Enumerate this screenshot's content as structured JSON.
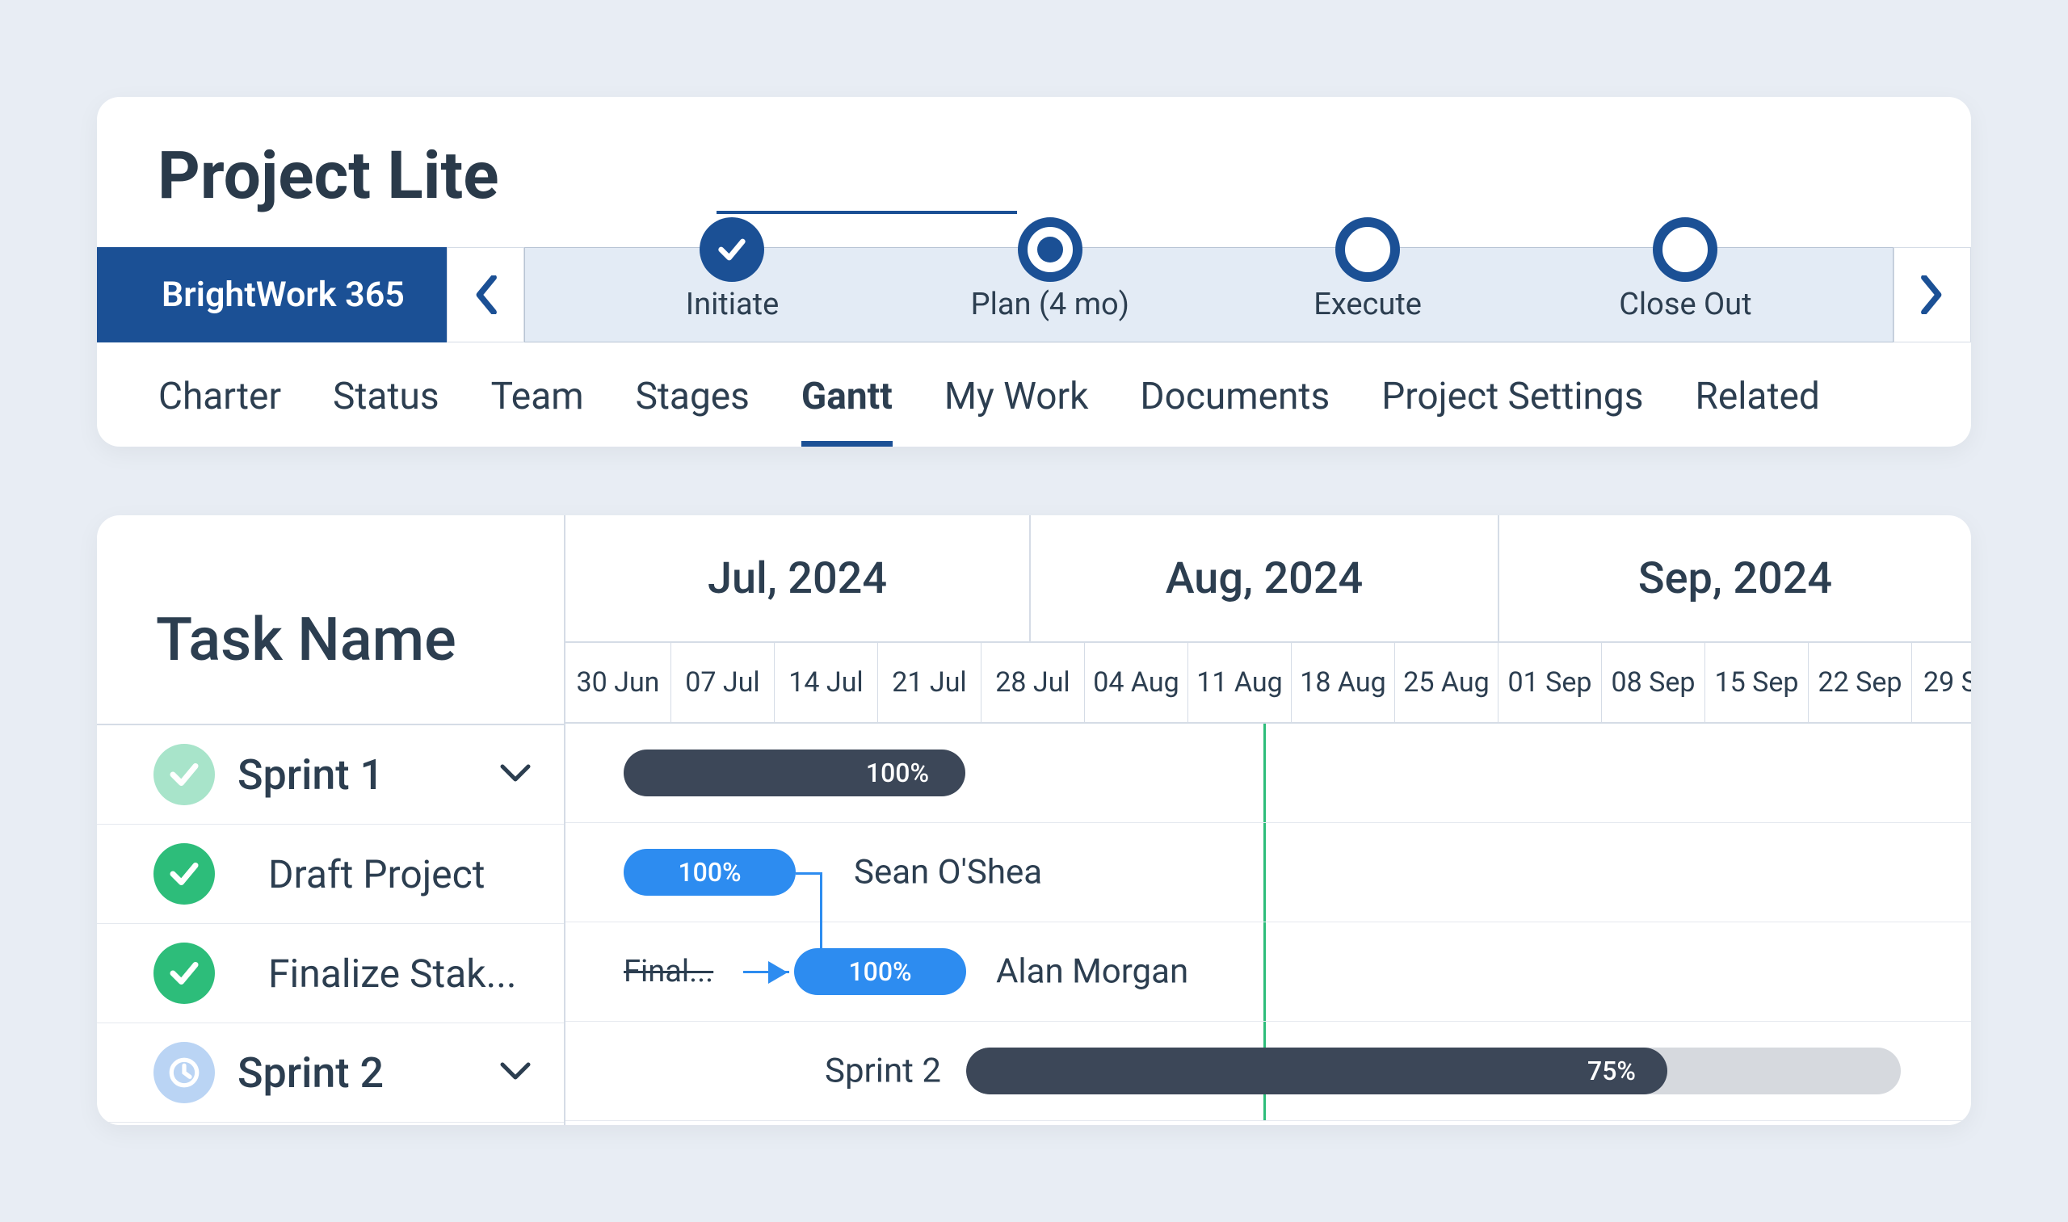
{
  "header": {
    "project_title": "Project Lite",
    "brand": "BrightWork 365",
    "stages": [
      {
        "label": "Initiate",
        "state": "done"
      },
      {
        "label": "Plan (4 mo)",
        "state": "active"
      },
      {
        "label": "Execute",
        "state": "pending"
      },
      {
        "label": "Close Out",
        "state": "pending"
      }
    ]
  },
  "tabs": [
    {
      "label": "Charter",
      "active": false
    },
    {
      "label": "Status",
      "active": false
    },
    {
      "label": "Team",
      "active": false
    },
    {
      "label": "Stages",
      "active": false
    },
    {
      "label": "Gantt",
      "active": true
    },
    {
      "label": "My Work",
      "active": false
    },
    {
      "label": "Documents",
      "active": false
    },
    {
      "label": "Project Settings",
      "active": false
    },
    {
      "label": "Related",
      "active": false
    }
  ],
  "gantt": {
    "column_header": "Task Name",
    "months": [
      {
        "label": "Jul, 2024",
        "weeks": 5
      },
      {
        "label": "Aug, 2024",
        "weeks": 4
      },
      {
        "label": "Sep, 2024",
        "weeks": 5
      }
    ],
    "weeks": [
      "30 Jun",
      "07 Jul",
      "14 Jul",
      "21 Jul",
      "28 Jul",
      "04 Aug",
      "11 Aug",
      "18 Aug",
      "25 Aug",
      "01 Sep",
      "08 Sep",
      "15 Sep",
      "22 Sep",
      "29 S"
    ],
    "tasks": [
      {
        "name": "Sprint 1",
        "type": "sprint",
        "status": "done-light",
        "bar_text": "100%"
      },
      {
        "name": "Draft Project",
        "type": "task",
        "status": "done",
        "bar_text": "100%",
        "assignee": "Sean O'Shea"
      },
      {
        "name": "Finalize Stak...",
        "type": "task",
        "status": "done",
        "bar_text": "100%",
        "assignee": "Alan Morgan",
        "strike": "Final..."
      },
      {
        "name": "Sprint 2",
        "type": "sprint",
        "status": "progress",
        "bar_label": "Sprint 2",
        "progress": "75%"
      }
    ]
  }
}
